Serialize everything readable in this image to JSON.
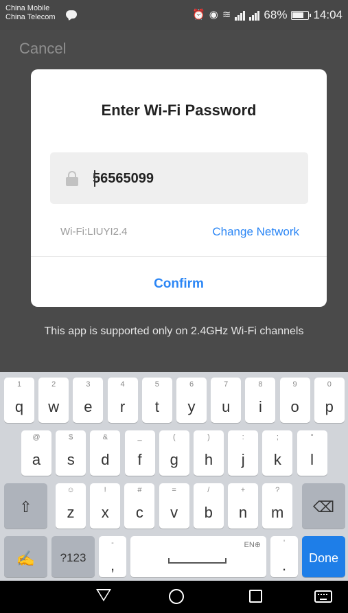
{
  "status_bar": {
    "carrier_1": "China Mobile",
    "carrier_2": "China Telecom",
    "battery": "68%",
    "time": "14:04"
  },
  "header": {
    "cancel_label": "Cancel"
  },
  "dialog": {
    "title": "Enter Wi-Fi Password",
    "password_value": "56565099",
    "wifi_label": "Wi-Fi:LIUYI2.4",
    "change_network_label": "Change Network",
    "confirm_label": "Confirm"
  },
  "notice": "This app is supported only on 2.4GHz Wi-Fi channels",
  "keyboard": {
    "row1": [
      {
        "main": "q",
        "sub": "1"
      },
      {
        "main": "w",
        "sub": "2"
      },
      {
        "main": "e",
        "sub": "3"
      },
      {
        "main": "r",
        "sub": "4"
      },
      {
        "main": "t",
        "sub": "5"
      },
      {
        "main": "y",
        "sub": "6"
      },
      {
        "main": "u",
        "sub": "7"
      },
      {
        "main": "i",
        "sub": "8"
      },
      {
        "main": "o",
        "sub": "9"
      },
      {
        "main": "p",
        "sub": "0"
      }
    ],
    "row2": [
      {
        "main": "a",
        "sub": "@"
      },
      {
        "main": "s",
        "sub": "$"
      },
      {
        "main": "d",
        "sub": "&"
      },
      {
        "main": "f",
        "sub": "_"
      },
      {
        "main": "g",
        "sub": "("
      },
      {
        "main": "h",
        "sub": ")"
      },
      {
        "main": "j",
        "sub": ":"
      },
      {
        "main": "k",
        "sub": ";"
      },
      {
        "main": "l",
        "sub": "\""
      }
    ],
    "row3": [
      {
        "main": "z",
        "sub": "☺"
      },
      {
        "main": "x",
        "sub": "!"
      },
      {
        "main": "c",
        "sub": "#"
      },
      {
        "main": "v",
        "sub": "="
      },
      {
        "main": "b",
        "sub": "/"
      },
      {
        "main": "n",
        "sub": "+"
      },
      {
        "main": "m",
        "sub": "?"
      }
    ],
    "shift_symbol": "⇧",
    "delete_symbol": "⌫",
    "handwriting_symbol": "✍",
    "symbols_label": "?123",
    "comma": ",",
    "comma_sub": "-",
    "space_sub": "EN⊕",
    "period": ".",
    "period_sub": "'",
    "done_label": "Done"
  }
}
